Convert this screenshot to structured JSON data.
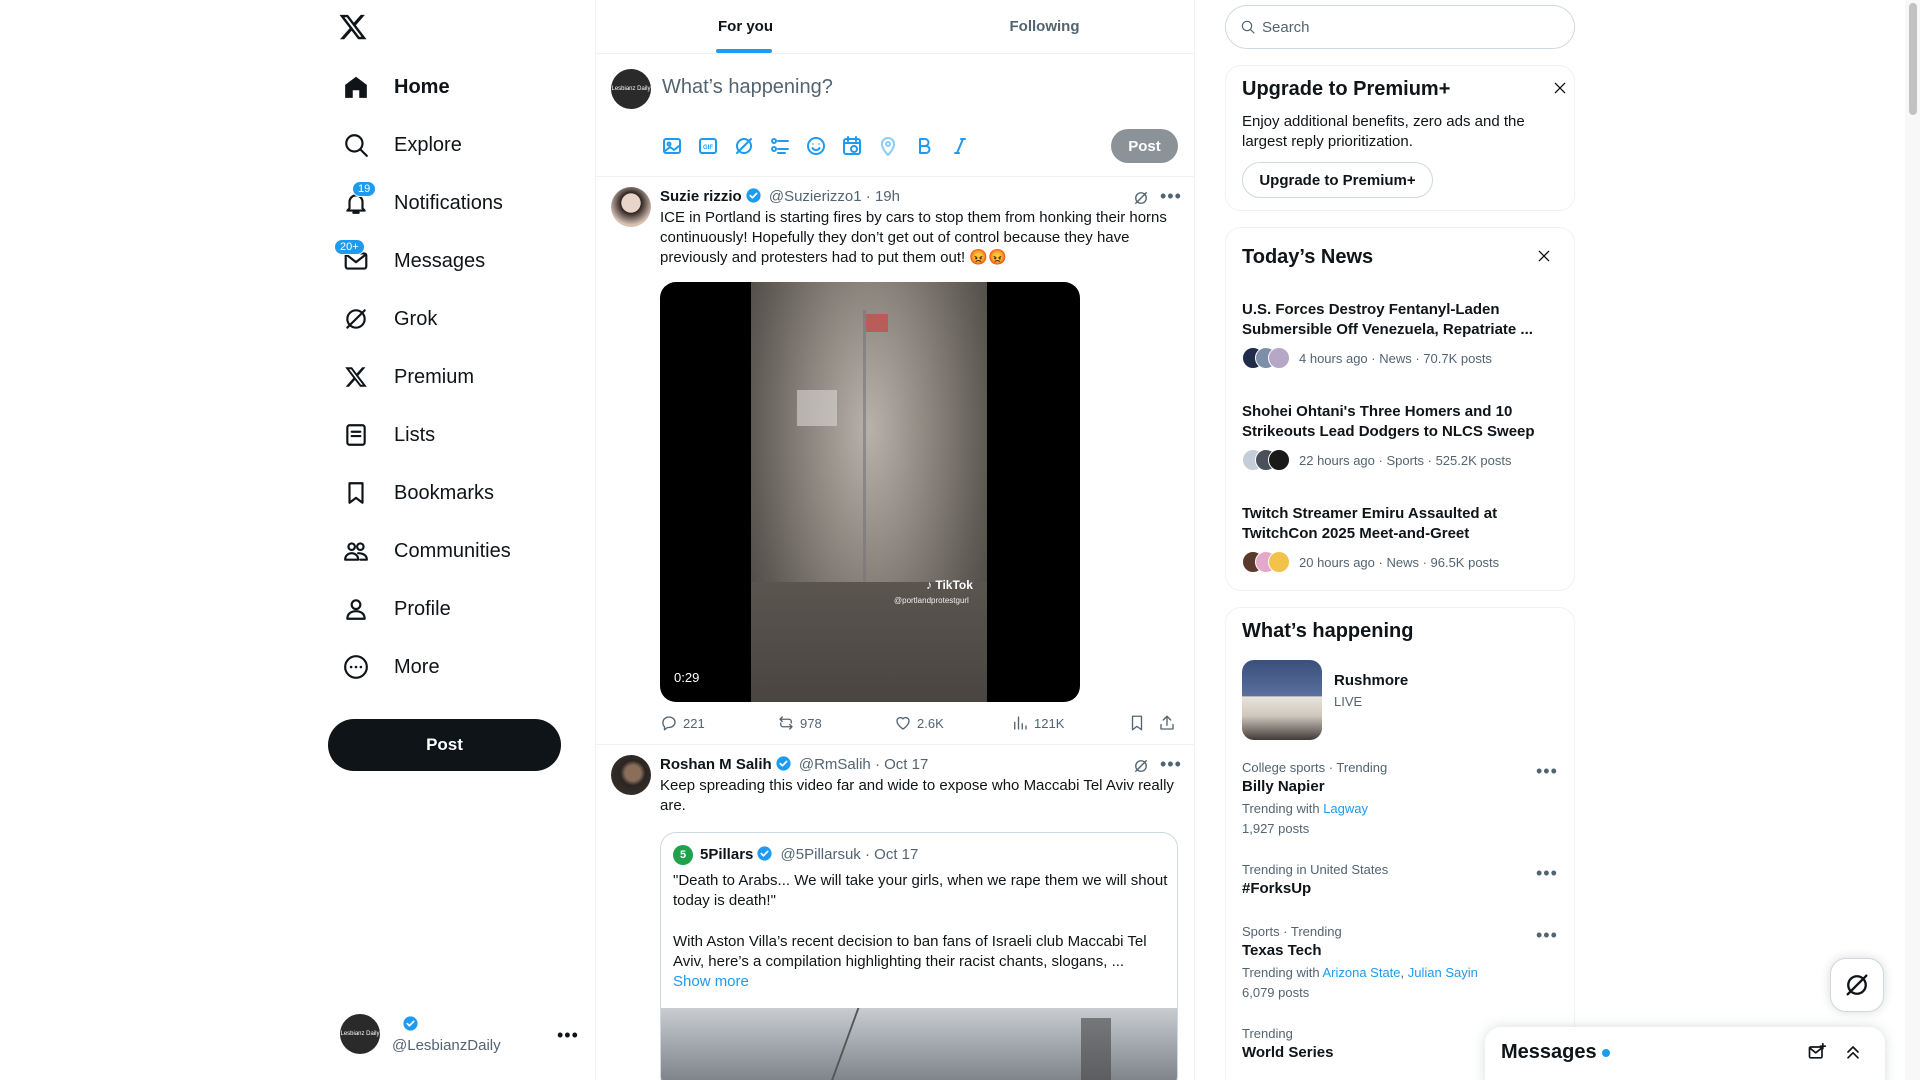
{
  "nav": {
    "items": [
      {
        "key": "home",
        "label": "Home",
        "badge": ""
      },
      {
        "key": "explore",
        "label": "Explore",
        "badge": ""
      },
      {
        "key": "notifications",
        "label": "Notifications",
        "badge": "19"
      },
      {
        "key": "messages",
        "label": "Messages",
        "badge": "20+"
      },
      {
        "key": "grok",
        "label": "Grok",
        "badge": ""
      },
      {
        "key": "premium",
        "label": "Premium",
        "badge": ""
      },
      {
        "key": "lists",
        "label": "Lists",
        "badge": ""
      },
      {
        "key": "bookmarks",
        "label": "Bookmarks",
        "badge": ""
      },
      {
        "key": "communities",
        "label": "Communities",
        "badge": ""
      },
      {
        "key": "profile",
        "label": "Profile",
        "badge": ""
      },
      {
        "key": "more",
        "label": "More",
        "badge": ""
      }
    ],
    "post_label": "Post"
  },
  "account": {
    "handle": "@LesbianzDaily",
    "avatar_text": "Lesbianz Daily"
  },
  "tabs": [
    {
      "label": "For you",
      "active": true
    },
    {
      "label": "Following",
      "active": false
    }
  ],
  "composer": {
    "placeholder": "What’s happening?",
    "post_label": "Post"
  },
  "tweets": [
    {
      "name": "Suzie rizzio",
      "handle": "@Suzierizzo1",
      "time": "19h",
      "text": "ICE in Portland is starting fires by cars to stop them from honking their horns continuously! Hopefully they don’t get out of control because they have previously and protesters had to put them out! 😡😡",
      "video": {
        "duration": "0:29",
        "watermark": "TikTok",
        "watermark_handle": "@portlandprotestgurl"
      },
      "stats": {
        "replies": "221",
        "reposts": "978",
        "likes": "2.6K",
        "views": "121K"
      }
    },
    {
      "name": "Roshan M Salih",
      "handle": "@RmSalih",
      "time": "Oct 17",
      "text": "Keep spreading this video far and wide to expose who Maccabi Tel Aviv really are.",
      "quote": {
        "name": "5Pillars",
        "handle": "@5Pillarsuk",
        "time": "Oct 17",
        "text1": "\"Death to Arabs... We will take your girls, when we rape them we will shout today is death!\"",
        "text2": "With Aston Villa’s recent decision to ban fans of Israeli club Maccabi Tel Aviv, here’s a compilation highlighting their racist chants, slogans, ...",
        "show_more": "Show more"
      }
    }
  ],
  "search": {
    "placeholder": "Search"
  },
  "premium": {
    "title": "Upgrade to Premium+",
    "body": "Enjoy additional benefits, zero ads and the largest reply prioritization.",
    "button": "Upgrade to Premium+"
  },
  "news": {
    "title": "Today’s News",
    "items": [
      {
        "headline": "U.S. Forces Destroy Fentanyl-Laden Submersible Off Venezuela, Repatriate ...",
        "meta": "4 hours ago · News · 70.7K posts"
      },
      {
        "headline": "Shohei Ohtani's Three Homers and 10 Strikeouts Lead Dodgers to NLCS Sweep",
        "meta": "22 hours ago · Sports · 525.2K posts"
      },
      {
        "headline": "Twitch Streamer Emiru Assaulted at TwitchCon 2025 Meet-and-Greet",
        "meta": "20 hours ago · News · 96.5K posts"
      }
    ]
  },
  "happening": {
    "title": "What’s happening",
    "live": {
      "name": "Rushmore",
      "status": "LIVE"
    },
    "trends": [
      {
        "context": "College sports · Trending",
        "name": "Billy Napier",
        "with_label": "Trending with",
        "with": [
          "Lagway"
        ],
        "posts": "1,927 posts"
      },
      {
        "context": "Trending in United States",
        "name": "#ForksUp",
        "with_label": "",
        "with": [],
        "posts": ""
      },
      {
        "context": "Sports · Trending",
        "name": "Texas Tech",
        "with_label": "Trending with",
        "with": [
          "Arizona State",
          "Julian Sayin"
        ],
        "posts": "6,079 posts"
      },
      {
        "context": "Trending",
        "name": "World Series",
        "with_label": "",
        "with": [],
        "posts": ""
      }
    ]
  },
  "messages_drawer": {
    "title": "Messages"
  },
  "colors": {
    "accent": "#1d9bf0",
    "text": "#0f1419",
    "secondary": "#536471",
    "border": "#eff3f4"
  }
}
